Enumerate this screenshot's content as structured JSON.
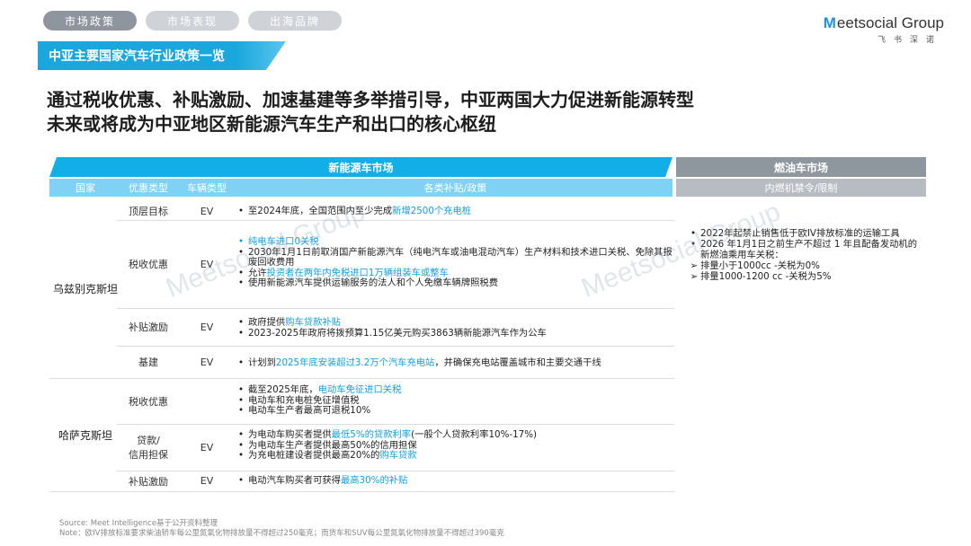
{
  "tabs": [
    "市场政策",
    "市场表现",
    "出海品牌"
  ],
  "logo": {
    "mark": "M",
    "name": "eetsocial Group",
    "subtitle": "飞书深诺"
  },
  "banner_title": "中亚主要国家汽车行业政策一览",
  "headline": [
    "通过税收优惠、补贴激励、加速基建等多举措引导，中亚两国大力促进新能源转型",
    "未来或将成为中亚地区新能源汽车生产和出口的核心枢纽"
  ],
  "table": {
    "nev_market": "新能源车市场",
    "ice_market": "燃油车市场",
    "sub_headers": {
      "country": "国家",
      "policy_type": "优惠类型",
      "vehicle_type": "车辆类型",
      "policy": "各类补贴/政策",
      "ice_policy": "内燃机禁令/限制"
    },
    "rows": [
      {
        "country": "乌兹别克斯坦",
        "type": "顶层目标",
        "vehicle": "EV"
      },
      {
        "type": "税收优惠",
        "vehicle": "EV"
      },
      {
        "type": "补贴激励",
        "vehicle": "EV"
      },
      {
        "type": "基建",
        "vehicle": "EV"
      },
      {
        "country": "哈萨克斯坦",
        "type": "税收优惠",
        "vehicle": ""
      },
      {
        "type_line1": "贷款/",
        "type_line2": "信用担保",
        "vehicle": "EV"
      },
      {
        "type": "补贴激励",
        "vehicle": "EV"
      }
    ],
    "content": {
      "r1": {
        "pre": "至2024年底，全国范围内至少完成",
        "hl": "新增2500个充电桩"
      },
      "r2": {
        "b1": "纯电车进口0关税",
        "b2": "2030年1月1日前取消国产新能源汽车（纯电汽车或油电混动汽车）生产材料和技术进口关税、免除其报废回收费用",
        "b3_pre": "允许",
        "b3_hl": "投资者在两年内免税进口1万辆组装车或整车",
        "b4": "使用新能源汽车提供运输服务的法人和个人免缴车辆牌照税费"
      },
      "r3": {
        "b1_pre": "政府提供",
        "b1_hl": "购车贷款补贴",
        "b2": "2023-2025年政府将拨预算1.15亿美元购买3863辆新能源汽车作为公车"
      },
      "r4": {
        "pre": "计划到",
        "hl": "2025年底安装超过3.2万个汽车充电站",
        "post": "，并确保充电站覆盖城市和主要交通干线"
      },
      "r5": {
        "b1_pre": "截至2025年底，",
        "b1_hl": "电动车免征进口关税",
        "b2": "电动车和充电桩免征增值税",
        "b3": "电动车生产者最高可退税10%"
      },
      "r6": {
        "b1_pre": "为电动车购买者提供",
        "b1_hl": "最低5%的贷款利率",
        "b1_post": "(一般个人贷款利率10%-17%)",
        "b2": "为电动车生产者提供最高50%的信用担保",
        "b3_pre": "为充电桩建设者提供最高20%的",
        "b3_hl": "购车贷款"
      },
      "r7": {
        "pre": "电动汽车购买者可获得",
        "hl": "最高30%的补贴"
      }
    },
    "ice": {
      "b1": "2022年起禁止销售低于欧IV排放标准的运输工具",
      "b2": "2026 年1月1日之前生产不超过 1 年且配备发动机的新燃油乘用车关税：",
      "a1": "排量小于1000cc -关税为0%",
      "a2": "排量1000-1200 cc -关税为5%",
      "arrow": "➢"
    }
  },
  "watermark": "Meetsocial Group",
  "watermark_sub": "飞书深诺",
  "footer": [
    "Source: Meet Intelligence基于公开资料整理",
    "Note：欧IV排放标准要求柴油轿车每公里氮氧化物排放量不得超过250毫克；而货车和SUV每公里氮氧化物排放量不得超过390毫克"
  ]
}
